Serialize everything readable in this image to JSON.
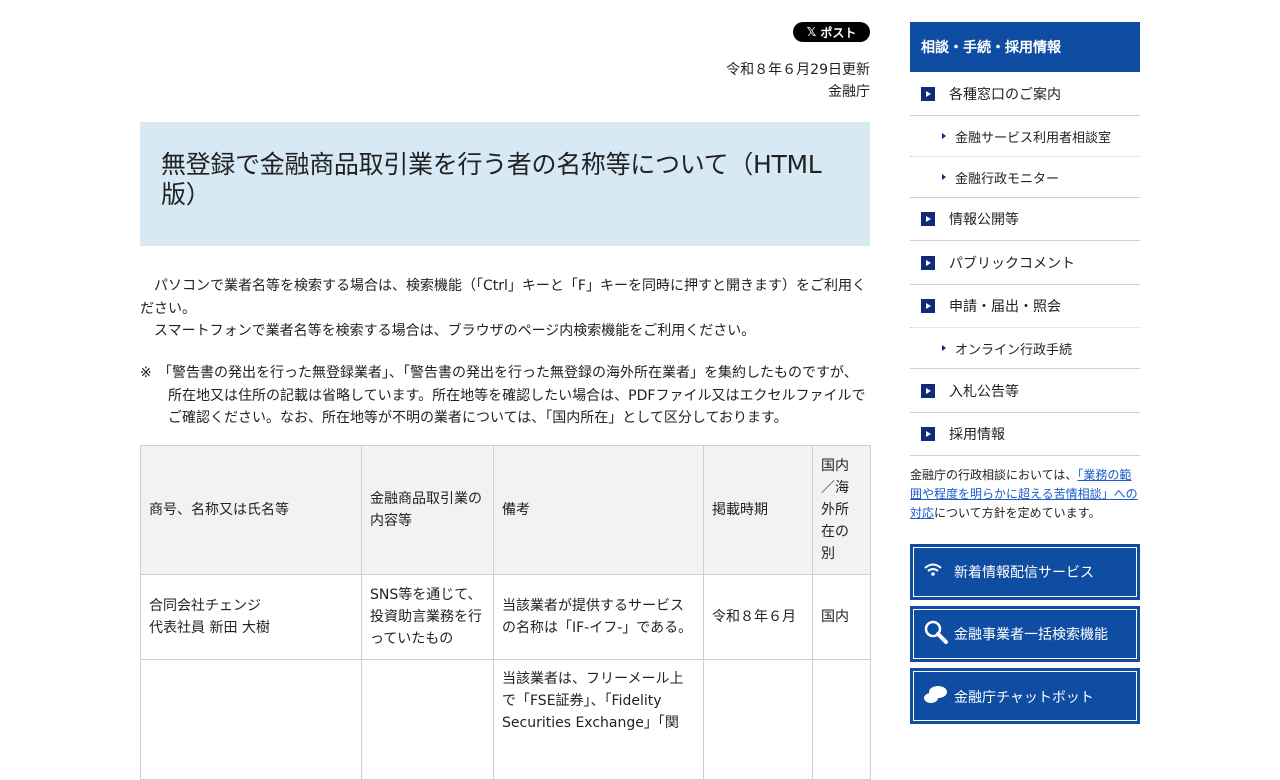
{
  "share": {
    "post_label": "ポスト",
    "x_glyph": "𝕏"
  },
  "meta": {
    "updated": "令和８年６月29日更新",
    "agency": "金融庁"
  },
  "title": "無登録で金融商品取引業を行う者の名称等について（HTML版）",
  "intro": {
    "p1": "　パソコンで業者名等を検索する場合は、検索機能（「Ctrl」キーと「F」キーを同時に押すと開きます）をご利用ください。",
    "p2": "　スマートフォンで業者名等を検索する場合は、ブラウザのページ内検索機能をご利用ください。",
    "note_mark": "※",
    "note": "「警告書の発出を行った無登録業者」、「警告書の発出を行った無登録の海外所在業者」を集約したものですが、所在地又は住所の記載は省略しています。所在地等を確認したい場合は、PDFファイル又はエクセルファイルでご確認ください。なお、所在地等が不明の業者については、「国内所在」として区分しております。"
  },
  "table": {
    "headers": [
      "商号、名称又は氏名等",
      "金融商品取引業の内容等",
      "備考",
      "掲載時期",
      "国内／海外所在の別"
    ],
    "rows": [
      {
        "name": "合同会社チェンジ\n代表社員 新田 大樹",
        "business": "SNS等を通じて、投資助言業務を行っていたもの",
        "remarks": "当該業者が提供するサービスの名称は「IF-イフ-」である。",
        "period": "令和８年６月",
        "region": "国内"
      },
      {
        "name": "",
        "business": "",
        "remarks": "当該業者は、フリーメール上で「FSE証券」、「Fidelity Securities Exchange」「関",
        "period": "",
        "region": ""
      }
    ]
  },
  "sidebar": {
    "heading": "相談・手続・採用情報",
    "items": [
      {
        "label": "各種窓口のご案内",
        "level": "main"
      },
      {
        "label": "金融サービス利用者相談室",
        "level": "sub"
      },
      {
        "label": "金融行政モニター",
        "level": "sub"
      },
      {
        "label": "情報公開等",
        "level": "main"
      },
      {
        "label": "パブリックコメント",
        "level": "main"
      },
      {
        "label": "申請・届出・照会",
        "level": "main"
      },
      {
        "label": "オンライン行政手続",
        "level": "sub"
      },
      {
        "label": "入札公告等",
        "level": "main"
      },
      {
        "label": "採用情報",
        "level": "main"
      }
    ],
    "consult_pre": "金融庁の行政相談においては、",
    "consult_link": "「業務の範囲や程度を明らかに超える苦情相談」への対応",
    "consult_post": "について方針を定めています。",
    "buttons": [
      {
        "label": "新着情報配信サービス",
        "icon": "wifi-icon"
      },
      {
        "label": "金融事業者一括検索機能",
        "icon": "search-icon"
      },
      {
        "label": "金融庁チャットボット",
        "icon": "chat-icon"
      }
    ],
    "colors": {
      "accent": "#0e4da2",
      "title_bg": "#d8e9f6",
      "link": "#1a5cc8"
    }
  }
}
